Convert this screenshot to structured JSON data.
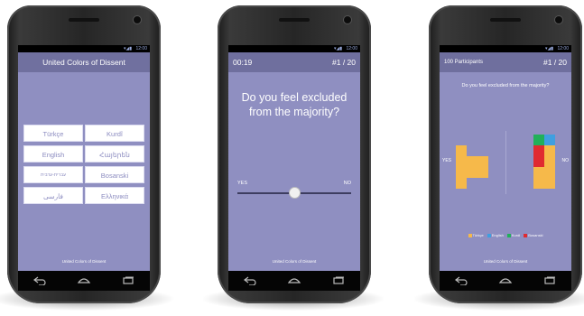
{
  "colors": {
    "background": "#8f8fc1",
    "header": "#70709f",
    "button_text": "#8c8cc0",
    "turkce": "#f6b94a",
    "english": "#3f9fe0",
    "kurdi": "#21b05a",
    "bosanski": "#e02a30"
  },
  "screen1": {
    "status_time": "12:00",
    "title": "United Colors of Dissent",
    "languages": [
      "Türkçe",
      "Kurdî",
      "English",
      "Հայերեն",
      "עברית-ערבית",
      "Bosanski",
      "فارسی",
      "Ελληνικά"
    ],
    "footer": "United Colors of Dissent"
  },
  "screen2": {
    "status_time": "12:00",
    "timer": "00:19",
    "progress": "#1 / 20",
    "question": "Do you feel excluded from the majority?",
    "slider_left": "YES",
    "slider_right": "NO",
    "slider_value": 0.5,
    "footer": "United Colors of Dissent"
  },
  "screen3": {
    "status_time": "12:00",
    "participants": "100 Participants",
    "progress": "#1 / 20",
    "question": "Do you feel excluded from the majority?",
    "label_yes": "YES",
    "label_no": "NO",
    "legend": [
      {
        "name": "Türkçe",
        "color": "#f6b94a"
      },
      {
        "name": "English",
        "color": "#3f9fe0"
      },
      {
        "name": "Kurdi",
        "color": "#21b05a"
      },
      {
        "name": "Bosanski",
        "color": "#e02a30"
      }
    ],
    "footer": "United Colors of Dissent"
  }
}
